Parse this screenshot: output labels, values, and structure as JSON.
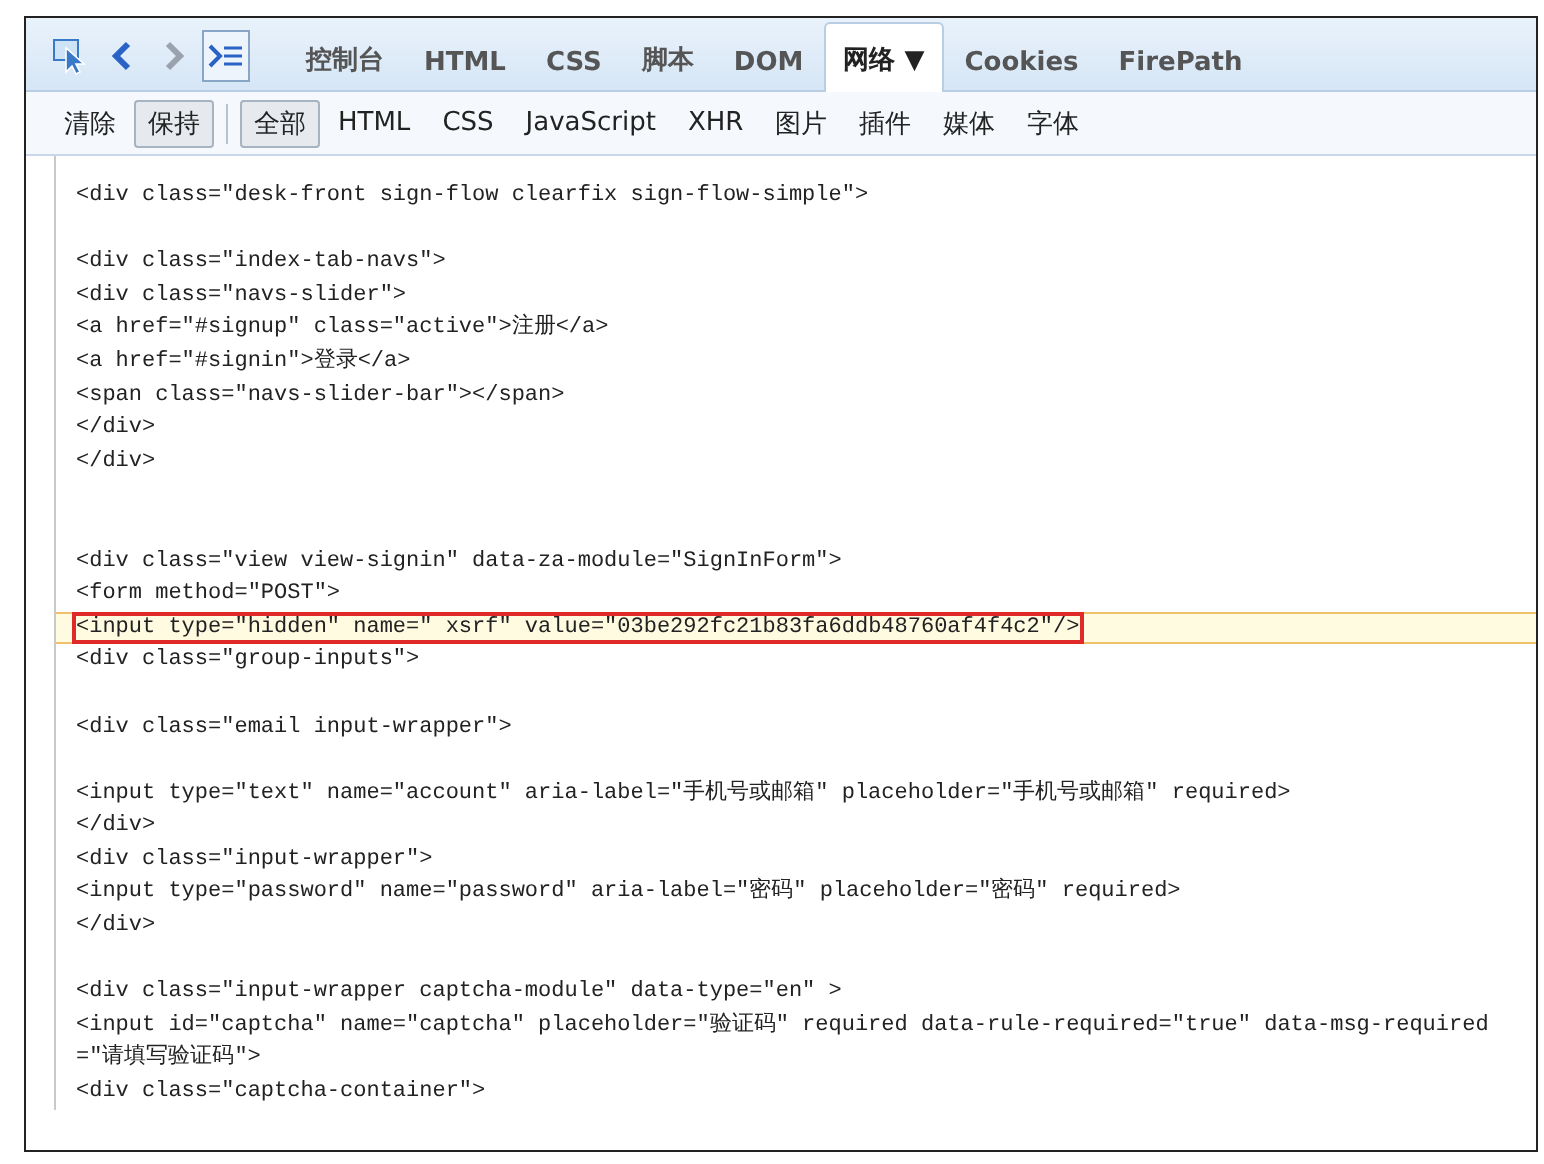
{
  "toolbar": {
    "tools": [
      {
        "kind": "inspect",
        "selected": false
      },
      {
        "kind": "back",
        "selected": false
      },
      {
        "kind": "forward",
        "selected": false
      },
      {
        "kind": "console",
        "selected": true
      }
    ],
    "tabs": [
      {
        "label": "控制台",
        "selected": false
      },
      {
        "label": "HTML",
        "selected": false
      },
      {
        "label": "CSS",
        "selected": false
      },
      {
        "label": "脚本",
        "selected": false
      },
      {
        "label": "DOM",
        "selected": false
      },
      {
        "label": "网络",
        "dropdown": "▼",
        "selected": true
      },
      {
        "label": "Cookies",
        "selected": false
      },
      {
        "label": "FirePath",
        "selected": false
      }
    ]
  },
  "filter_bar": {
    "actions": [
      {
        "label": "清除",
        "pressed": false
      },
      {
        "label": "保持",
        "pressed": true
      }
    ],
    "filters": [
      {
        "label": "全部",
        "selected": true
      },
      {
        "label": "HTML",
        "selected": false
      },
      {
        "label": "CSS",
        "selected": false
      },
      {
        "label": "JavaScript",
        "selected": false
      },
      {
        "label": "XHR",
        "selected": false
      },
      {
        "label": "图片",
        "selected": false
      },
      {
        "label": "插件",
        "selected": false
      },
      {
        "label": "媒体",
        "selected": false
      },
      {
        "label": "字体",
        "selected": false
      }
    ]
  },
  "code_lines": [
    {
      "kind": "code",
      "text": "<div class=\"desk-front sign-flow clearfix sign-flow-simple\">",
      "highlighted": false
    },
    {
      "kind": "blank"
    },
    {
      "kind": "code",
      "text": "<div class=\"index-tab-navs\">",
      "highlighted": false
    },
    {
      "kind": "code",
      "text": "<div class=\"navs-slider\">",
      "highlighted": false
    },
    {
      "kind": "code",
      "text": "<a href=\"#signup\" class=\"active\">注册</a>",
      "highlighted": false
    },
    {
      "kind": "code",
      "text": "<a href=\"#signin\">登录</a>",
      "highlighted": false
    },
    {
      "kind": "code",
      "text": "<span class=\"navs-slider-bar\"></span>",
      "highlighted": false
    },
    {
      "kind": "code",
      "text": "</div>",
      "highlighted": false
    },
    {
      "kind": "code",
      "text": "</div>",
      "highlighted": false
    },
    {
      "kind": "blank"
    },
    {
      "kind": "blank"
    },
    {
      "kind": "code",
      "text": "<div class=\"view view-signin\" data-za-module=\"SignInForm\">",
      "highlighted": false
    },
    {
      "kind": "code",
      "text": "<form method=\"POST\">",
      "highlighted": false
    },
    {
      "kind": "code",
      "text": "<input type=\"hidden\" name=\" xsrf\" value=\"03be292fc21b83fa6ddb48760af4f4c2\"/>",
      "highlighted": true
    },
    {
      "kind": "code",
      "text": "<div class=\"group-inputs\">",
      "highlighted": false
    },
    {
      "kind": "blank"
    },
    {
      "kind": "code",
      "text": "<div class=\"email input-wrapper\">",
      "highlighted": false
    },
    {
      "kind": "blank"
    },
    {
      "kind": "code",
      "text": "<input type=\"text\" name=\"account\" aria-label=\"手机号或邮箱\" placeholder=\"手机号或邮箱\" required>",
      "highlighted": false
    },
    {
      "kind": "code",
      "text": "</div>",
      "highlighted": false
    },
    {
      "kind": "code",
      "text": "<div class=\"input-wrapper\">",
      "highlighted": false
    },
    {
      "kind": "code",
      "text": "<input type=\"password\" name=\"password\" aria-label=\"密码\" placeholder=\"密码\" required>",
      "highlighted": false
    },
    {
      "kind": "code",
      "text": "</div>",
      "highlighted": false
    },
    {
      "kind": "blank"
    },
    {
      "kind": "code",
      "text": "<div class=\"input-wrapper captcha-module\" data-type=\"en\" >",
      "highlighted": false
    },
    {
      "kind": "code",
      "text": "<input id=\"captcha\" name=\"captcha\" placeholder=\"验证码\" required data-rule-required=\"true\" data-msg-required",
      "highlighted": false
    },
    {
      "kind": "code",
      "text": "=\"请填写验证码\">",
      "highlighted": false
    },
    {
      "kind": "code",
      "text": "<div class=\"captcha-container\">",
      "highlighted": false
    }
  ]
}
